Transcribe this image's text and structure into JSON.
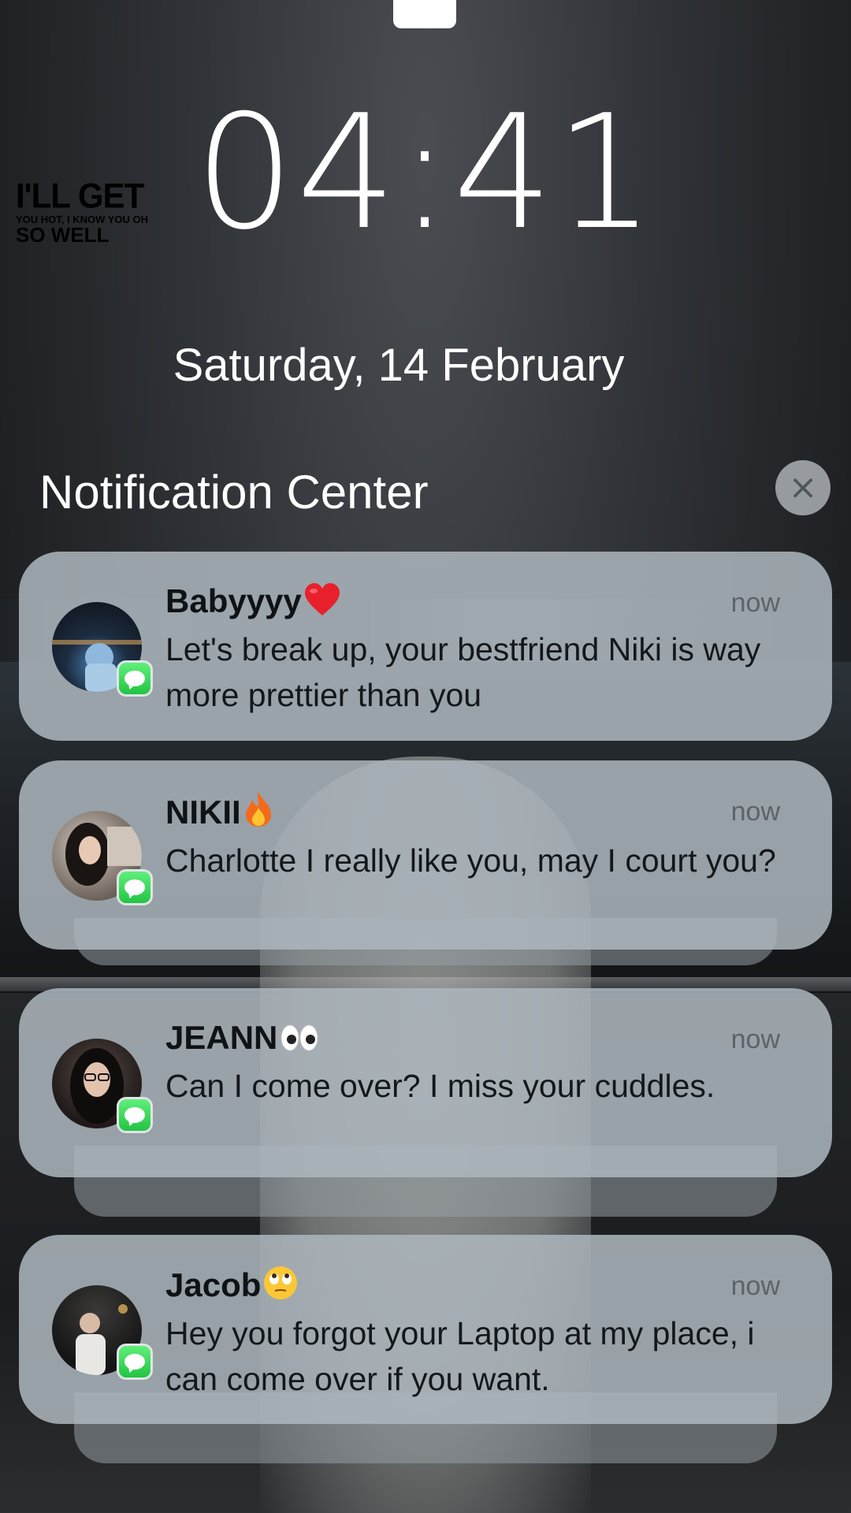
{
  "sticker": {
    "line1": "I'LL GET",
    "line2": "YOU HOT, I KNOW YOU OH",
    "line3": "SO WELL"
  },
  "lockscreen": {
    "time": "04:41",
    "date": "Saturday, 14 February"
  },
  "notification_center": {
    "title": "Notification Center",
    "close_glyph": "×"
  },
  "notifications": [
    {
      "sender": "Babyyyy",
      "emoji": "heart",
      "time": "now",
      "message": "Let's break up, your bestfriend Niki is way more prettier than you",
      "app": "messages-icon"
    },
    {
      "sender": "NIKII",
      "emoji": "fire",
      "time": "now",
      "message": "Charlotte I really like you, may I court you?",
      "app": "messages-icon"
    },
    {
      "sender": "JEANN",
      "emoji": "eyes",
      "time": "now",
      "message": "Can I come over? I miss your cuddles.",
      "app": "messages-icon"
    },
    {
      "sender": "Jacob",
      "emoji": "eye-roll",
      "time": "now",
      "message": "Hey you forgot your Laptop at my place, i can come over if you want.",
      "app": "messages-icon"
    }
  ],
  "colors": {
    "card": "#adb7be",
    "messages_green": "#34c759",
    "text_primary": "#101316",
    "text_time": "#5d6368"
  }
}
